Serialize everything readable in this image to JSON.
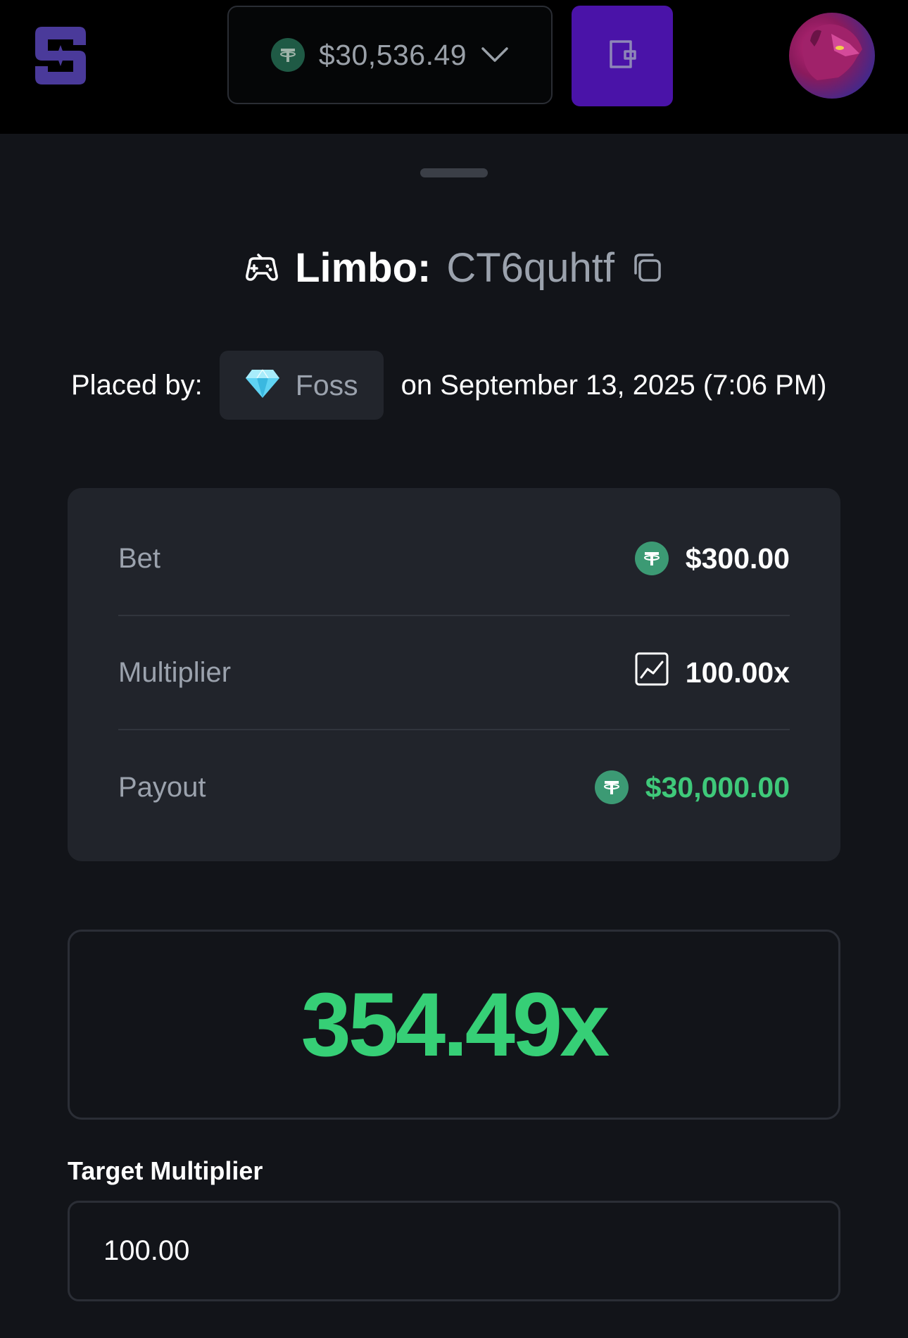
{
  "header": {
    "balance": "$30,536.49",
    "currency_icon": "tether-icon",
    "wallet_icon": "wallet-icon",
    "colors": {
      "wallet_button": "#4a13a8",
      "logo": "#4a3a9a"
    }
  },
  "bet": {
    "game": "Limbo:",
    "bet_id": "CT6quhtf",
    "placed_by_label": "Placed by:",
    "user": "Foss",
    "user_badge_icon": "diamond-icon",
    "date": "on September 13, 2025 (7:06 PM)"
  },
  "details": {
    "bet_label": "Bet",
    "bet_value": "$300.00",
    "multiplier_label": "Multiplier",
    "multiplier_value": "100.00x",
    "payout_label": "Payout",
    "payout_value": "$30,000.00",
    "colors": {
      "payout": "#3fc97a"
    }
  },
  "result": {
    "value": "354.49x",
    "color": "#36cf76"
  },
  "target": {
    "label": "Target Multiplier",
    "value": "100.00"
  }
}
